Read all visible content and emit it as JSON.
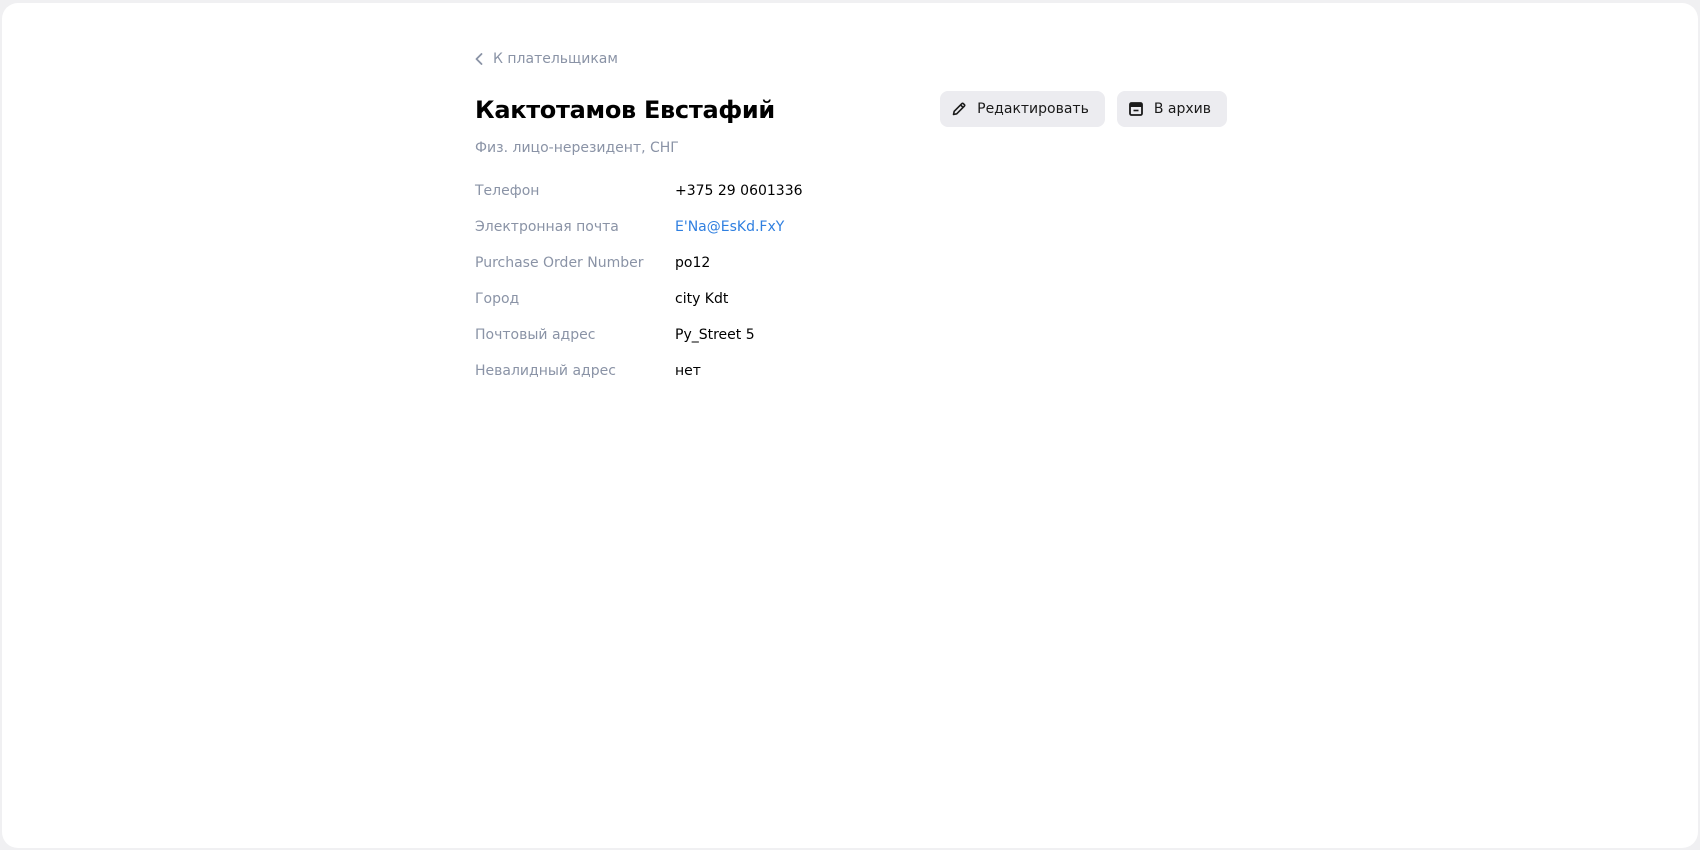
{
  "header": {
    "back_label": "К плательщикам",
    "title": "Кактотамов Евстафий",
    "subtitle": "Физ. лицо-нерезидент, СНГ"
  },
  "actions": {
    "edit_label": "Редактировать",
    "archive_label": "В архив"
  },
  "properties": [
    {
      "label": "Телефон",
      "value": "+375 29 0601336"
    },
    {
      "label": "Электронная почта",
      "value": "E'Na@EsKd.FxY"
    },
    {
      "label": "Purchase Order Number",
      "value": "po12"
    },
    {
      "label": "Город",
      "value": "city Kdt"
    },
    {
      "label": "Почтовый адрес",
      "value": "Py_Street 5"
    },
    {
      "label": "Невалидный адрес",
      "value": "нет"
    }
  ],
  "colors": {
    "muted_text": "#8a93a6",
    "link": "#2f7fe0",
    "button_bg": "#ececf0"
  },
  "icons": {
    "back": "chevron-left-icon",
    "edit": "pencil-icon",
    "archive": "archive-box-icon"
  }
}
